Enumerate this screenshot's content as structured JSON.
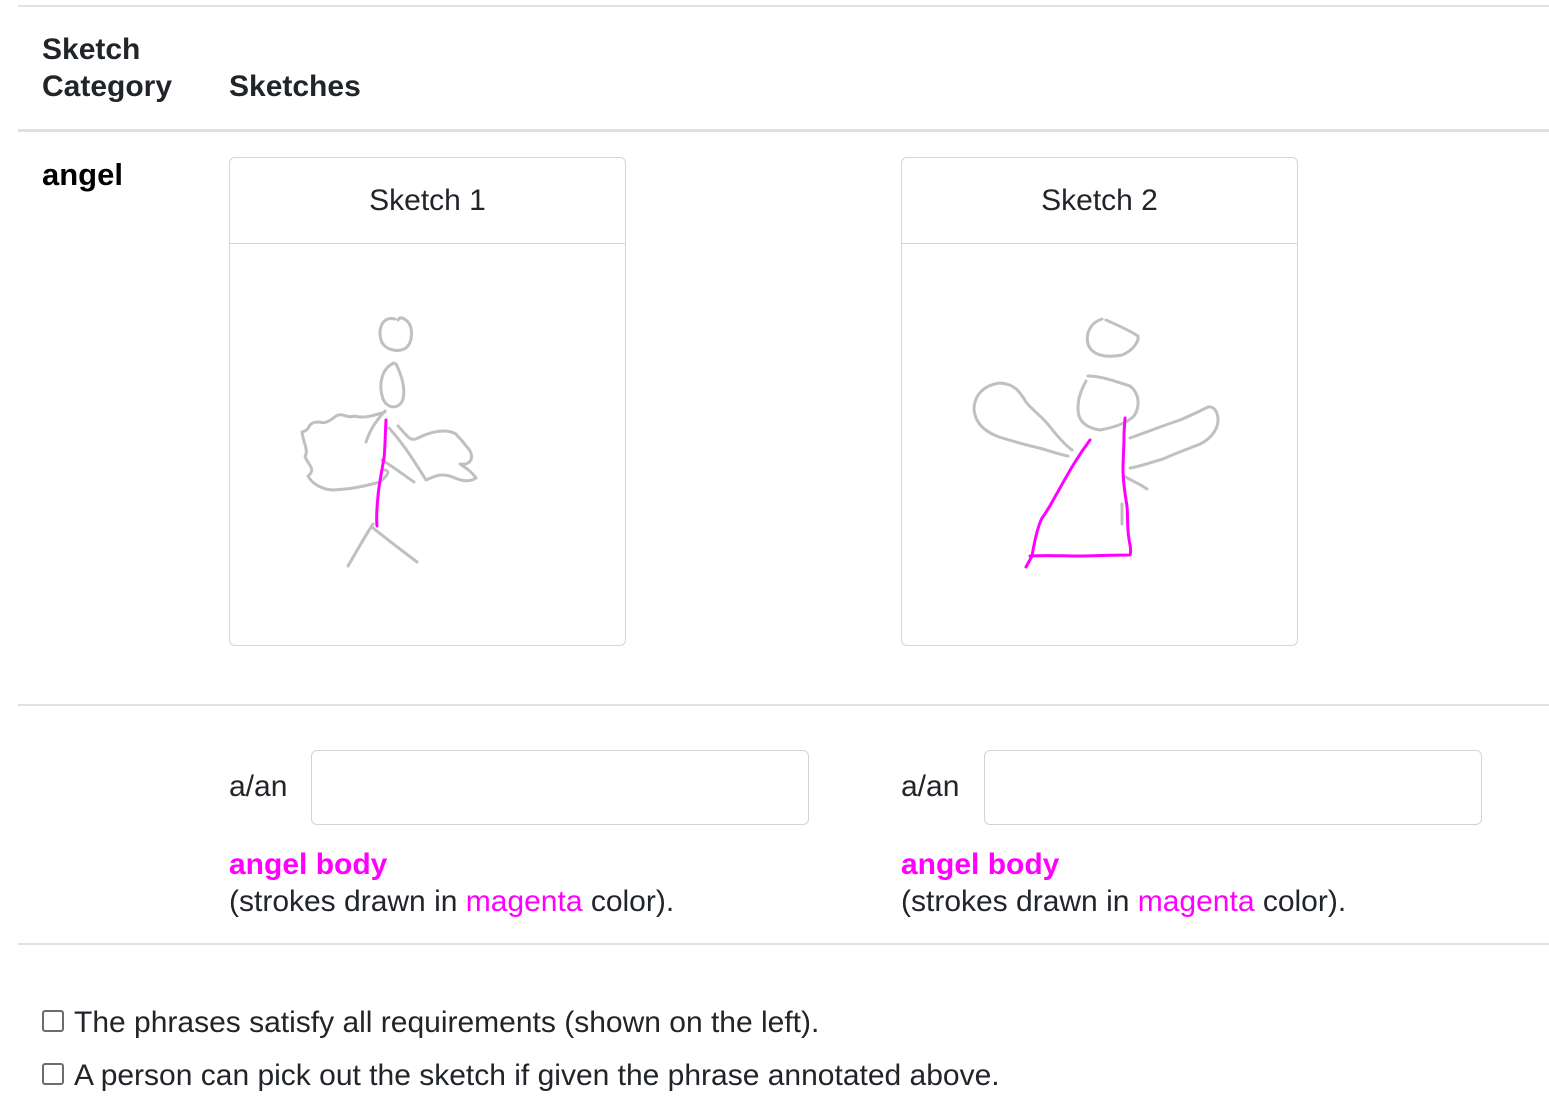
{
  "table": {
    "header_category": "Sketch Category",
    "header_sketches": "Sketches",
    "category": "angel"
  },
  "sketches": [
    {
      "title": "Sketch 1",
      "phrase_prefix": "a/an",
      "phrase_value": "",
      "part_name": "angel body",
      "note_before": "(strokes drawn in ",
      "note_color_word": "magenta",
      "note_after": " color)."
    },
    {
      "title": "Sketch 2",
      "phrase_prefix": "a/an",
      "phrase_value": "",
      "part_name": "angel body",
      "note_before": "(strokes drawn in ",
      "note_color_word": "magenta",
      "note_after": " color)."
    }
  ],
  "checks": [
    {
      "label": "The phrases satisfy all requirements (shown on the left).",
      "checked": false
    },
    {
      "label": "A person can pick out the sketch if given the phrase annotated above.",
      "checked": false
    }
  ],
  "colors": {
    "highlight": "#ff00ff",
    "stroke": "#c0c0c0",
    "border": "#dee2e6"
  }
}
